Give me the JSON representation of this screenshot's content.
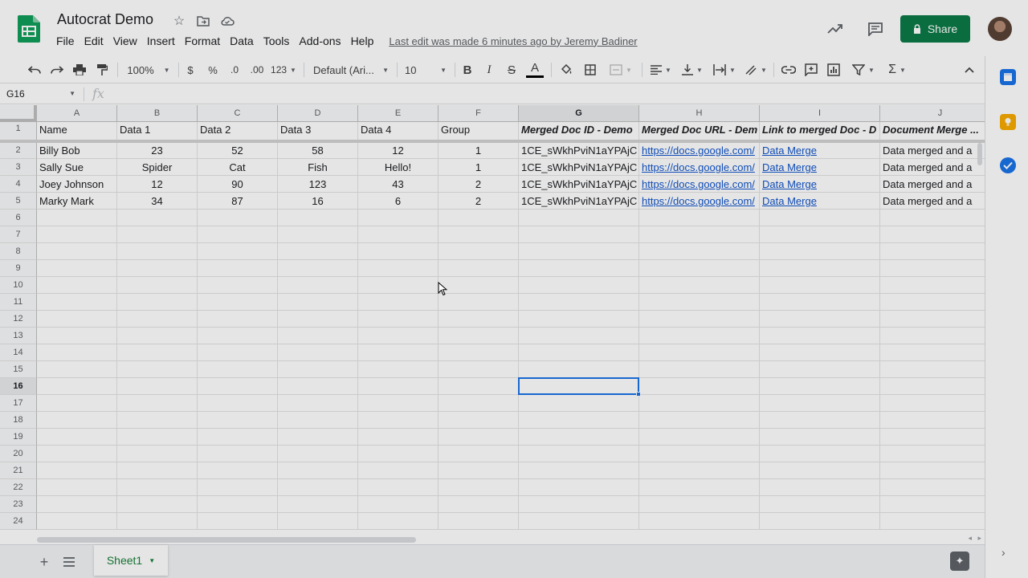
{
  "header": {
    "title": "Autocrat Demo",
    "last_edit": "Last edit was made 6 minutes ago by Jeremy Badiner",
    "share_label": "Share",
    "menus": [
      "File",
      "Edit",
      "View",
      "Insert",
      "Format",
      "Data",
      "Tools",
      "Add-ons",
      "Help"
    ]
  },
  "toolbar": {
    "zoom": "100%",
    "currency": "$",
    "percent": "%",
    "dec_decrease": ".0",
    "dec_increase": ".00",
    "more_formats": "123",
    "font": "Default (Ari...",
    "font_size": "10",
    "bold": "B",
    "italic": "I",
    "strike": "S",
    "text_color": "A",
    "functions": "Σ"
  },
  "formula_bar": {
    "cell_ref": "G16",
    "fx": "fx"
  },
  "grid": {
    "columns": [
      "A",
      "B",
      "C",
      "D",
      "E",
      "F",
      "G",
      "H",
      "I",
      "J"
    ],
    "rows": [
      "1",
      "2",
      "3",
      "4",
      "5",
      "6",
      "7",
      "8",
      "9",
      "10",
      "11",
      "12",
      "13",
      "14",
      "15",
      "16",
      "17",
      "18",
      "19",
      "20",
      "21",
      "22",
      "23",
      "24"
    ],
    "headers": [
      "Name",
      "Data 1",
      "Data 2",
      "Data 3",
      "Data 4",
      "Group",
      "Merged Doc ID - Demo",
      "Merged Doc URL - Dem",
      "Link to merged Doc - D",
      "Document Merge ..."
    ],
    "data": [
      [
        "Billy Bob",
        "23",
        "52",
        "58",
        "12",
        "1",
        "1CE_sWkhPviN1aYPAjC",
        "https://docs.google.com/",
        "Data Merge",
        "Data merged and a"
      ],
      [
        "Sally Sue",
        "Spider",
        "Cat",
        "Fish",
        "Hello!",
        "1",
        "1CE_sWkhPviN1aYPAjC",
        "https://docs.google.com/",
        "Data Merge",
        "Data merged and a"
      ],
      [
        "Joey Johnson",
        "12",
        "90",
        "123",
        "43",
        "2",
        "1CE_sWkhPviN1aYPAjC",
        "https://docs.google.com/",
        "Data Merge",
        "Data merged and a"
      ],
      [
        "Marky Mark",
        "34",
        "87",
        "16",
        "6",
        "2",
        "1CE_sWkhPviN1aYPAjC",
        "https://docs.google.com/",
        "Data Merge",
        "Data merged and a"
      ]
    ]
  },
  "bottom": {
    "sheet_tab": "Sheet1"
  },
  "colors": {
    "share": "#0b7a47",
    "link": "#1155cc",
    "selection": "#1a73e8",
    "sheet_tab": "#188038"
  }
}
